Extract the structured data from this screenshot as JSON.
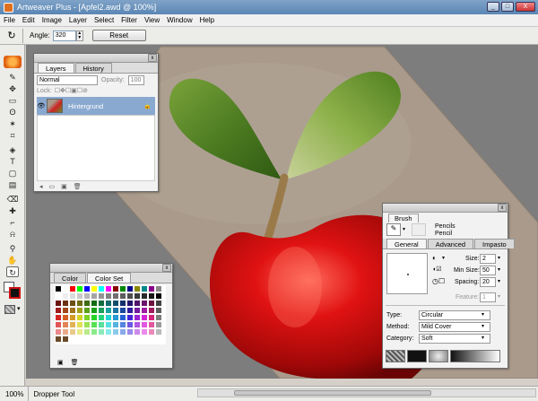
{
  "window": {
    "title": "Artweaver Plus - [Apfel2.awd @ 100%]",
    "controls": [
      "_",
      "□",
      "X"
    ]
  },
  "menu": [
    "File",
    "Edit",
    "Image",
    "Layer",
    "Select",
    "Filter",
    "View",
    "Window",
    "Help"
  ],
  "options": {
    "angle_label": "Angle:",
    "angle_value": "320",
    "reset_label": "Reset"
  },
  "tools": [
    {
      "name": "brush",
      "glyph": "✎"
    },
    {
      "name": "move",
      "glyph": "✥"
    },
    {
      "name": "rect-select",
      "glyph": "▭"
    },
    {
      "name": "lasso",
      "glyph": "ʘ"
    },
    {
      "name": "magic-wand",
      "glyph": "✶"
    },
    {
      "name": "crop",
      "glyph": "⌗"
    },
    {
      "name": "fill",
      "glyph": "◈"
    },
    {
      "name": "text",
      "glyph": "T"
    },
    {
      "name": "shape",
      "glyph": "▢"
    },
    {
      "name": "gradient",
      "glyph": "▤"
    },
    {
      "name": "eraser",
      "glyph": "⌫"
    },
    {
      "name": "clone",
      "glyph": "✚"
    },
    {
      "name": "dropper",
      "glyph": "⌐"
    },
    {
      "name": "bucket",
      "glyph": "⍾"
    },
    {
      "name": "zoom",
      "glyph": "⚲"
    },
    {
      "name": "hand",
      "glyph": "✋"
    },
    {
      "name": "rotate",
      "glyph": "↻"
    }
  ],
  "layers_panel": {
    "tabs": [
      "Layers",
      "History"
    ],
    "blend_mode": "Normal",
    "opacity_label": "Opacity:",
    "opacity_value": "100",
    "lock_label": "Lock:",
    "layer_name": "Hintergrund"
  },
  "color_panel": {
    "tabs": [
      "Color",
      "Color Set"
    ]
  },
  "brush_panel": {
    "title": "Brush",
    "category": "Pencils",
    "variant": "Pencil",
    "tabs": [
      "General",
      "Advanced",
      "Impasto"
    ],
    "size_label": "Size:",
    "size_value": "2",
    "min_size_label": "Min Size:",
    "min_size_value": "50",
    "spacing_label": "Spacing:",
    "spacing_value": "20",
    "feature_label": "Feature:",
    "feature_value": "1",
    "type_label": "Type:",
    "type_value": "Circular",
    "method_label": "Method:",
    "method_value": "Mild Cover",
    "category_label": "Category:",
    "category_value": "Soft"
  },
  "status": {
    "zoom": "100%",
    "tool": "Dropper Tool"
  },
  "colors": {
    "foreground": "#111111",
    "background": "#ffffff",
    "accent": "#cc1111"
  }
}
